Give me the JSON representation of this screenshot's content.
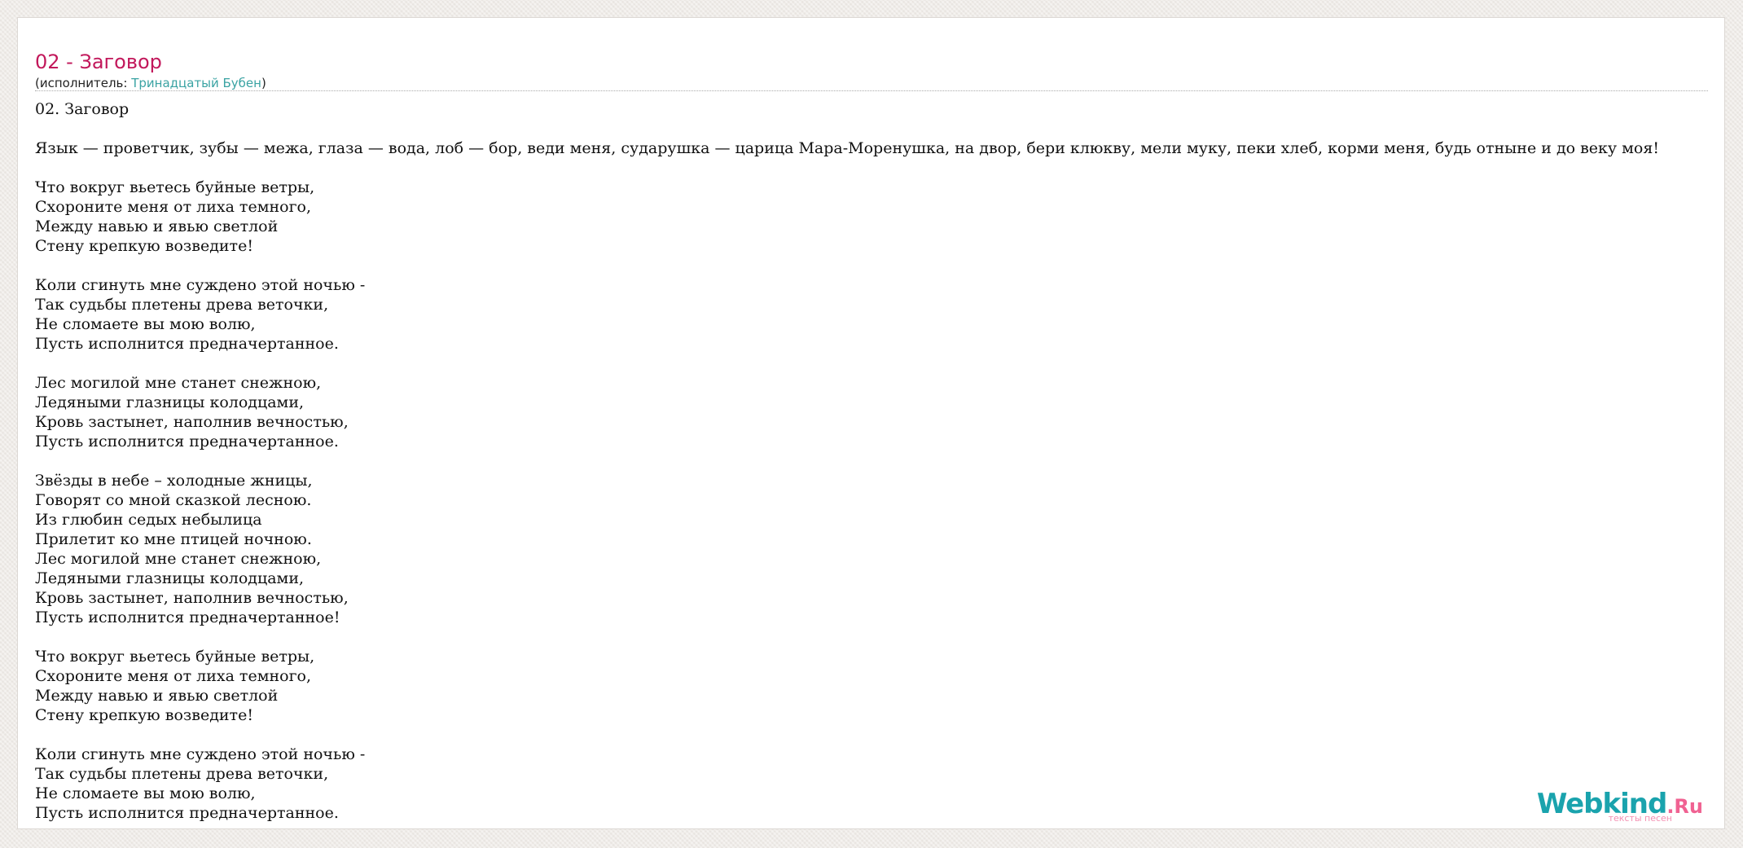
{
  "song": {
    "title": "02 - Заговор",
    "performer_prefix": "(исполнитель: ",
    "performer_name": "Тринадцатый Бубен",
    "performer_suffix": ")"
  },
  "lyrics": [
    "02. Заговор",
    "",
    "Язык — проветчик, зубы — межа, глаза — вода, лоб — бор, веди меня, сударушка — царица Мара-Моренушка, на двор, бери клюкву, мели муку, пеки хлеб, корми меня, будь отныне и до веку моя!",
    "",
    "Что вокруг вьетесь буйные ветры,",
    "Схороните меня от лиха темного,",
    "Между навью и явью светлой",
    "Стену крепкую возведите!",
    "",
    "Коли сгинуть мне суждено этой ночью -",
    "Так судьбы плетены древа веточки,",
    "Не сломаете вы мою волю,",
    "Пусть исполнится предначертанное.",
    "",
    "Лес могилой мне станет снежною,",
    "Ледяными глазницы колодцами,",
    "Кровь застынет, наполнив вечностью,",
    "Пусть исполнится предначертанное.",
    "",
    "Звёзды в небе – холодные жницы,",
    "Говорят со мной сказкой лесною.",
    "Из глюбин седых небылица",
    "Прилетит ко мне птицей ночною.",
    "Лес могилой мне станет снежною,",
    "Ледяными глазницы колодцами,",
    "Кровь застынет, наполнив вечностью,",
    "Пусть исполнится предначертанное!",
    "",
    "Что вокруг вьетесь буйные ветры,",
    "Схороните меня от лиха темного,",
    "Между навью и явью светлой",
    "Стену крепкую возведите!",
    "",
    "Коли сгинуть мне суждено этой ночью -",
    "Так судьбы плетены древа веточки,",
    "Не сломаете вы мою волю,",
    "Пусть исполнится предначертанное."
  ],
  "logo": {
    "word": "Webkind",
    "tld": ".Ru",
    "tagline": "тексты песен"
  },
  "colors": {
    "title": "#c2185b",
    "link": "#3aa3a3",
    "logo_primary": "#1aa3ad",
    "logo_accent": "#f06292"
  }
}
